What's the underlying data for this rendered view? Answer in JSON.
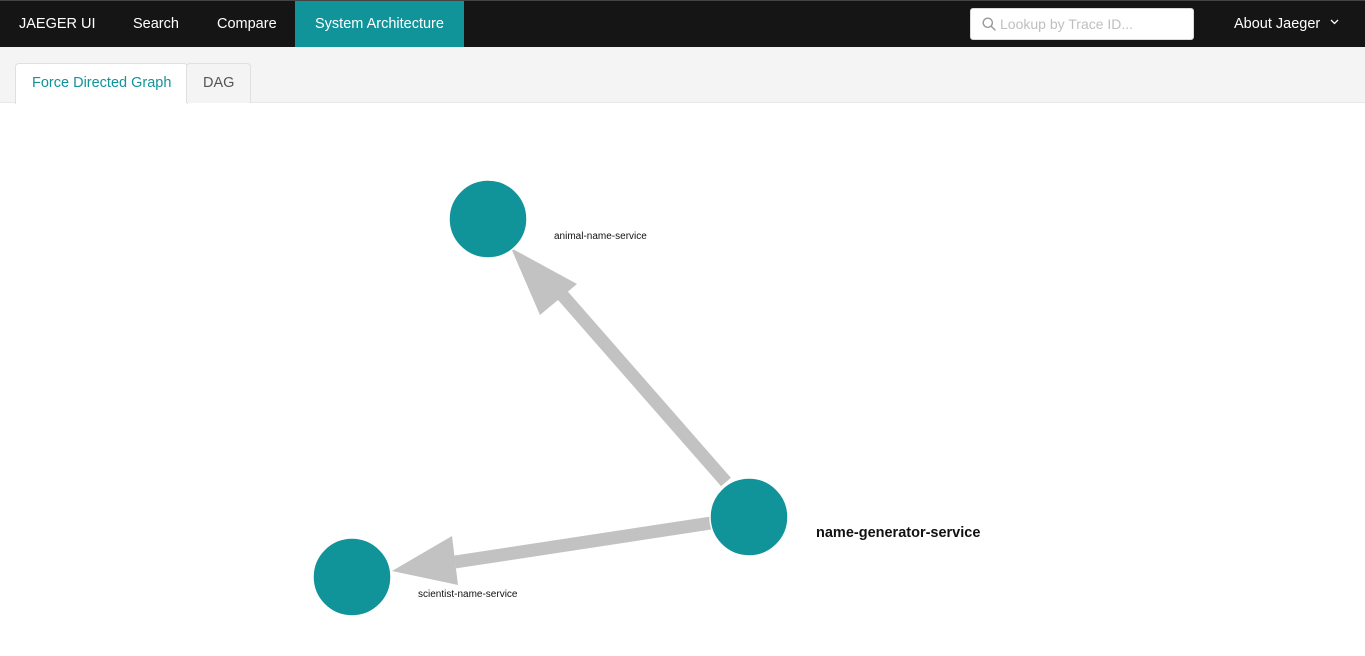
{
  "nav": {
    "brand": "JAEGER UI",
    "items": [
      {
        "label": "Search"
      },
      {
        "label": "Compare"
      },
      {
        "label": "System Architecture",
        "active": true
      }
    ],
    "search_placeholder": "Lookup by Trace ID...",
    "about_label": "About Jaeger"
  },
  "tabs": [
    {
      "label": "Force Directed Graph",
      "active": true
    },
    {
      "label": "DAG",
      "active": false
    }
  ],
  "graph": {
    "nodes": [
      {
        "id": "animal-name-service",
        "label": "animal-name-service"
      },
      {
        "id": "name-generator-service",
        "label": "name-generator-service",
        "highlighted": true
      },
      {
        "id": "scientist-name-service",
        "label": "scientist-name-service"
      }
    ],
    "edges": [
      {
        "from": "name-generator-service",
        "to": "animal-name-service"
      },
      {
        "from": "name-generator-service",
        "to": "scientist-name-service"
      }
    ]
  },
  "colors": {
    "nav_bg": "#151515",
    "accent": "#11939a",
    "node": "#11939a",
    "edge": "#c2c2c2",
    "tab_bg": "#f4f4f4"
  }
}
